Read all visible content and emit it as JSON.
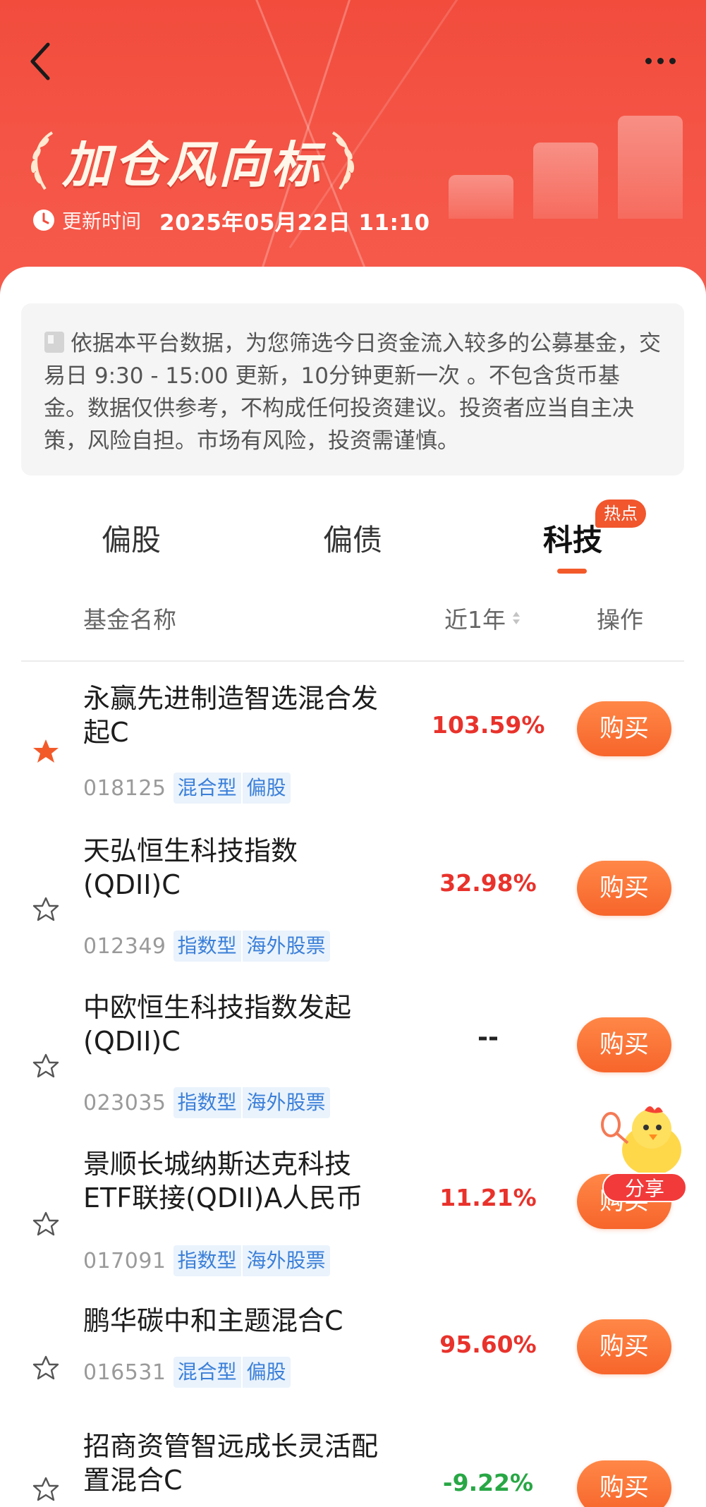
{
  "header": {
    "title": "加仓风向标",
    "update_label": "更新时间",
    "update_time": "2025年05月22日 11:10"
  },
  "notice": {
    "text": "依据本平台数据，为您筛选今日资金流入较多的公募基金，交易日 9:30 - 15:00 更新，10分钟更新一次 。不包含货币基金。数据仅供参考，不构成任何投资建议。投资者应当自主决策，风险自担。市场有风险，投资需谨慎。"
  },
  "tabs": [
    {
      "label": "偏股",
      "active": false
    },
    {
      "label": "偏债",
      "active": false
    },
    {
      "label": "科技",
      "active": true,
      "badge": "热点"
    }
  ],
  "columns": {
    "name": "基金名称",
    "return": "近1年",
    "action": "操作"
  },
  "funds": [
    {
      "name_line1": "永赢先进制造智选混合发",
      "name_line2": "起C",
      "code": "018125",
      "tags": [
        "混合型",
        "偏股"
      ],
      "return": "103.59%",
      "favorited": true
    },
    {
      "name_line1": "天弘恒生科技指数",
      "name_line2": "(QDII)C",
      "code": "012349",
      "tags": [
        "指数型",
        "海外股票"
      ],
      "return": "32.98%",
      "favorited": false
    },
    {
      "name_line1": "中欧恒生科技指数发起",
      "name_line2": "(QDII)C",
      "code": "023035",
      "tags": [
        "指数型",
        "海外股票"
      ],
      "return": "--",
      "favorited": false
    },
    {
      "name_line1": "景顺长城纳斯达克科技",
      "name_line2": "ETF联接(QDII)A人民币",
      "code": "017091",
      "tags": [
        "指数型",
        "海外股票"
      ],
      "return": "11.21%",
      "favorited": false
    },
    {
      "name_line1": "鹏华碳中和主题混合C",
      "name_line2": "",
      "code": "016531",
      "tags": [
        "混合型",
        "偏股"
      ],
      "return": "95.60%",
      "favorited": false
    },
    {
      "name_line1": "招商资管智远成长灵活配",
      "name_line2": "置混合C",
      "code": "",
      "tags": [],
      "return": "-9.22%",
      "favorited": false
    }
  ],
  "buy_label": "购买",
  "share_label": "分享",
  "colors": {
    "header_red": "#f24c3d",
    "up_red": "#e8322b",
    "down_green": "#28a745",
    "button_orange": "#f7652b",
    "tag_blue": "#3b7fd8"
  },
  "icons": {
    "back": "back-arrow-icon",
    "more": "more-dots-icon",
    "clock": "clock-icon",
    "notice": "document-icon",
    "star": "star-icon"
  }
}
